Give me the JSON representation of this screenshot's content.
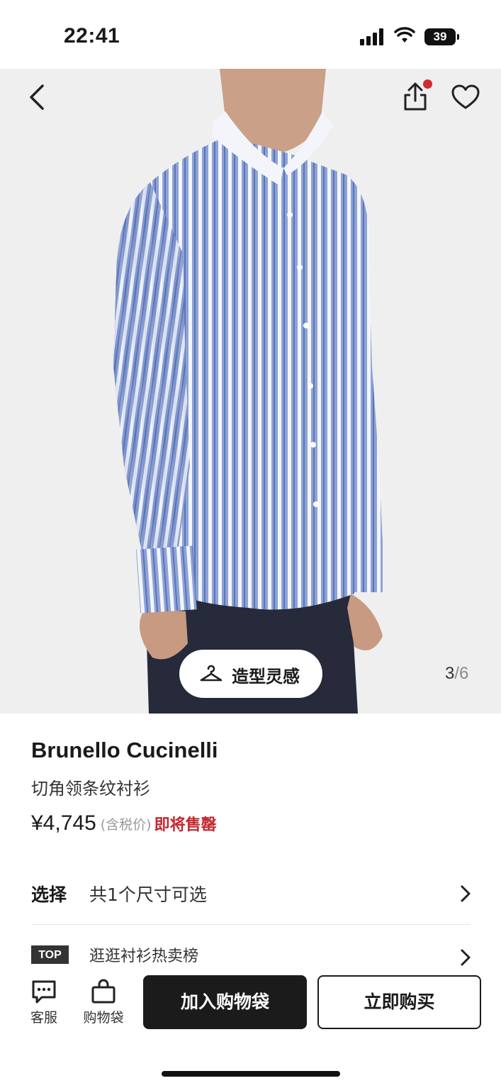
{
  "status_bar": {
    "time": "22:41",
    "battery": "39"
  },
  "hero": {
    "style_button": "造型灵感",
    "page_current": "3",
    "page_sep": "/",
    "page_total": "6"
  },
  "product": {
    "brand": "Brunello Cucinelli",
    "name": "切角领条纹衬衫",
    "price": "¥4,745",
    "tax_note": "(含税价)",
    "stock_status": "即将售罄"
  },
  "options": {
    "select_title": "选择",
    "select_text": "共1个尺寸可选",
    "top_badge": "TOP",
    "top_text": "逛逛衬衫热卖榜"
  },
  "bottom_bar": {
    "service_label": "客服",
    "bag_label": "购物袋",
    "add_to_bag": "加入购物袋",
    "buy_now": "立即购买"
  },
  "colors": {
    "accent": "#c4262e",
    "button_dark": "#1b1b1b",
    "image_bg": "#efefef"
  }
}
